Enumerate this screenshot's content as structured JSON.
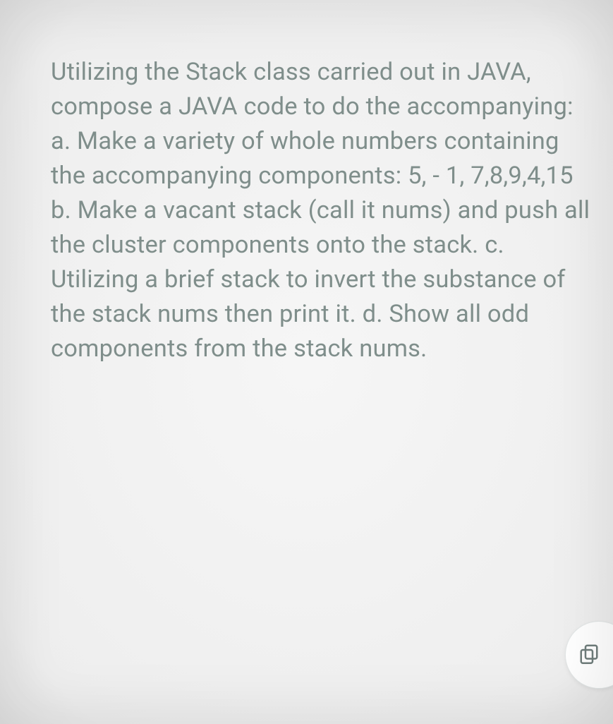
{
  "question": {
    "text": "Utilizing the Stack class carried out in JAVA, compose a JAVA code to do the accompanying: a. Make a variety of whole numbers containing the accompanying components: 5, - 1, 7,8,9,4,15 b. Make a vacant stack (call it nums) and push all the cluster components onto the stack. c. Utilizing a brief stack to invert the substance of the stack nums then print it. d. Show all odd components from the stack nums."
  },
  "fab": {
    "icon": "copy-icon"
  }
}
